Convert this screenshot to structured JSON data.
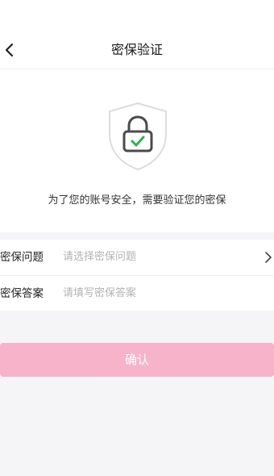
{
  "header": {
    "title": "密保验证"
  },
  "hero": {
    "message": "为了您的账号安全，需要验证您的密保"
  },
  "form": {
    "question": {
      "label": "密保问题",
      "placeholder": "请选择密保问题"
    },
    "answer": {
      "label": "密保答案",
      "placeholder": "请填写密保答案"
    }
  },
  "actions": {
    "confirm_label": "确认"
  },
  "icons": {
    "back": "chevron-left-icon",
    "security": "shield-lock-icon",
    "select": "chevron-right-icon"
  },
  "colors": {
    "accent": "#f7b3c9",
    "check": "#2bb24c"
  }
}
